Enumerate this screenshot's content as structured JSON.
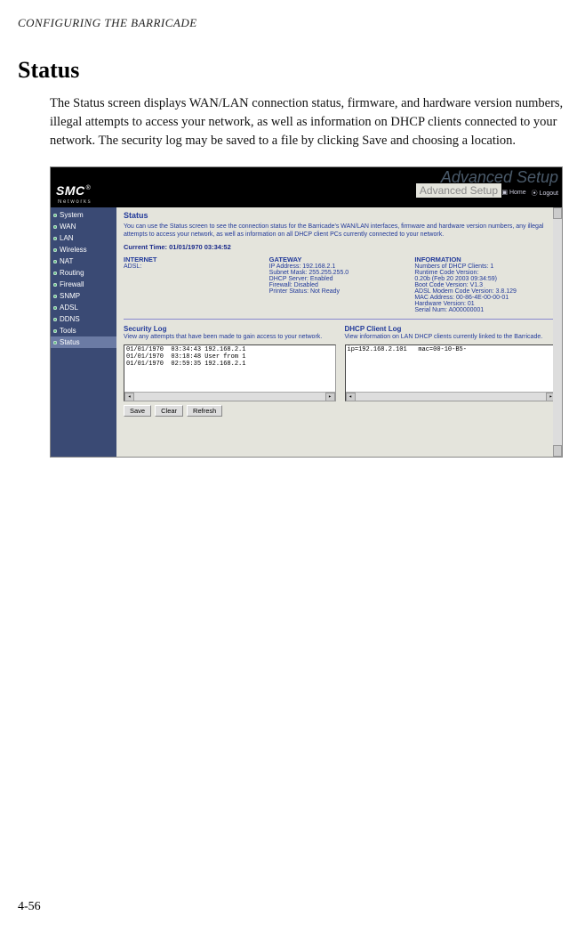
{
  "page": {
    "running_head": "CONFIGURING THE BARRICADE",
    "section_title": "Status",
    "paragraph": "The Status screen displays WAN/LAN connection status, firmware, and hardware version numbers, illegal attempts to access your network, as well as information on DHCP clients connected to your network. The security log may be saved to a file by clicking Save and choosing a location.",
    "page_number": "4-56"
  },
  "ui": {
    "brand": "SMC",
    "brand_reg": "®",
    "brand_sub": "N e t w o r k s",
    "adv_watermark": "Advanced Setup",
    "adv_label": "Advanced Setup",
    "top_links": {
      "home": "Home",
      "logout": "Logout"
    },
    "sidebar": {
      "items": [
        {
          "label": "System"
        },
        {
          "label": "WAN"
        },
        {
          "label": "LAN"
        },
        {
          "label": "Wireless"
        },
        {
          "label": "NAT"
        },
        {
          "label": "Routing"
        },
        {
          "label": "Firewall"
        },
        {
          "label": "SNMP"
        },
        {
          "label": "ADSL"
        },
        {
          "label": "DDNS"
        },
        {
          "label": "Tools"
        },
        {
          "label": "Status"
        }
      ]
    },
    "main": {
      "title": "Status",
      "description": "You can use the Status screen to see the connection status for the Barricade's WAN/LAN interfaces, firmware and hardware version numbers, any illegal attempts to access your network, as well as information on all DHCP client PCs currently connected to your network.",
      "current_time_label": "Current Time: 01/01/1970 03:34:52",
      "cols": {
        "internet": {
          "header": "INTERNET",
          "line1": "ADSL:"
        },
        "gateway": {
          "header": "GATEWAY",
          "lines": [
            "IP Address:   192.168.2.1",
            "Subnet Mask:   255.255.255.0",
            "DHCP Server:   Enabled",
            "Firewall:   Disabled",
            "Printer Status:  Not Ready"
          ]
        },
        "information": {
          "header": "INFORMATION",
          "lines": [
            "Numbers of DHCP Clients:  1",
            "Runtime Code Version:",
            "  0.20b (Feb 20 2003 09:34:59)",
            "Boot Code Version:  V1.3",
            "ADSL Modem Code Version:  3.8.129",
            "MAC Address:  00-86-4E-00-00-01",
            "Hardware Version:  01",
            "Serial Num:   A000000001"
          ]
        }
      },
      "security_log": {
        "title": "Security Log",
        "desc": "View any attempts that have been made to gain access to your network.",
        "content": "01/01/1970  03:34:43 192.168.2.1\n01/01/1970  03:18:48 User from 1\n01/01/1970  02:59:35 192.168.2.1"
      },
      "dhcp_log": {
        "title": "DHCP Client Log",
        "desc": "View information on LAN DHCP clients currently linked to the Barricade.",
        "content": "ip=192.168.2.101   mac=00-10-B5-"
      },
      "buttons": {
        "save": "Save",
        "clear": "Clear",
        "refresh": "Refresh"
      }
    }
  }
}
